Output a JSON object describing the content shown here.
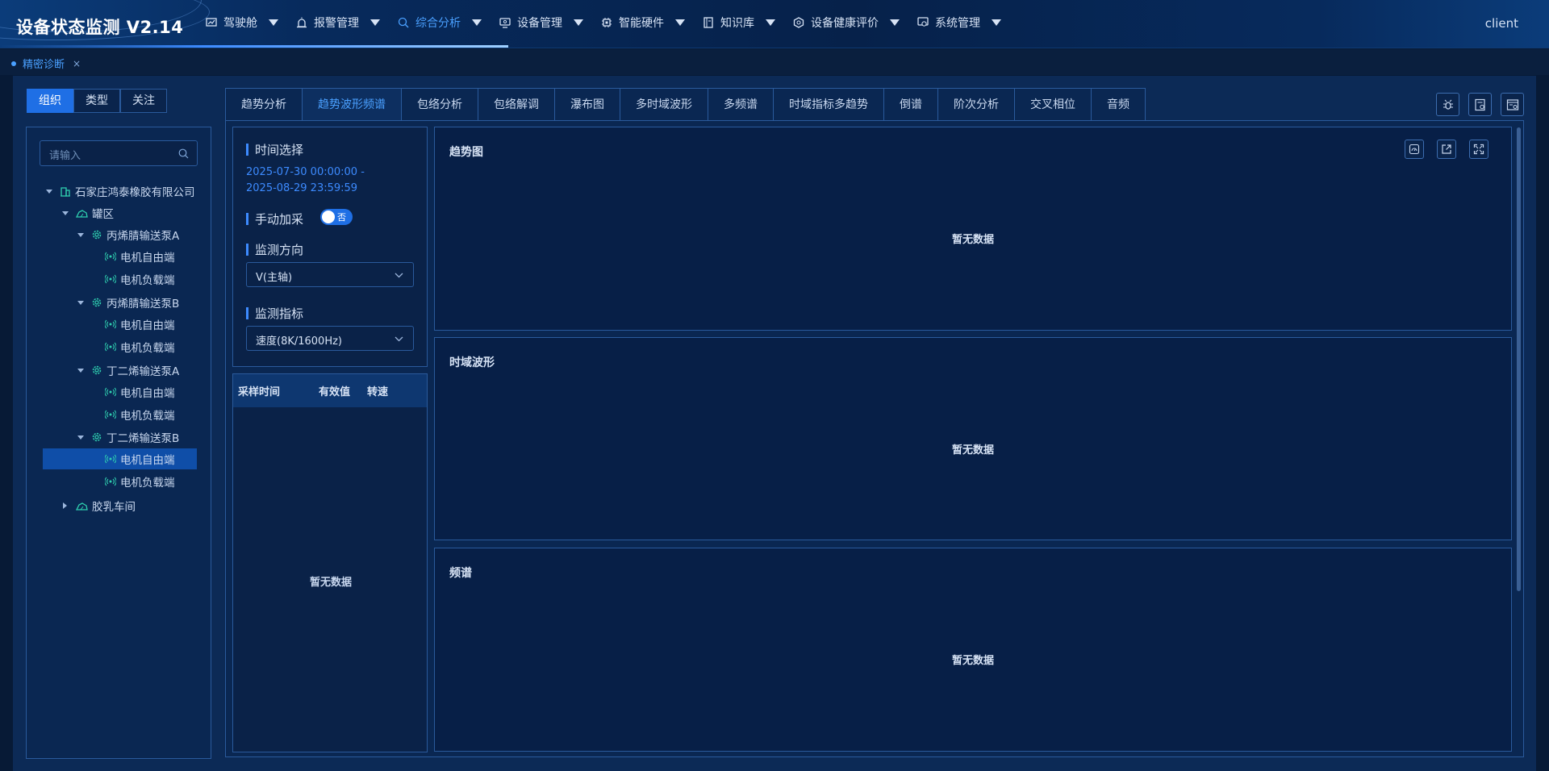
{
  "app": {
    "title": "设备状态监测 V2.14",
    "user": "client"
  },
  "nav": [
    {
      "label": "驾驶舱",
      "icon": "monitor-chart-icon"
    },
    {
      "label": "报警管理",
      "icon": "alarm-light-icon"
    },
    {
      "label": "综合分析",
      "icon": "analysis-search-icon"
    },
    {
      "label": "设备管理",
      "icon": "device-screen-icon"
    },
    {
      "label": "智能硬件",
      "icon": "chip-icon"
    },
    {
      "label": "知识库",
      "icon": "book-icon"
    },
    {
      "label": "设备健康评价",
      "icon": "hexagon-gear-icon"
    },
    {
      "label": "系统管理",
      "icon": "settings-screen-icon"
    }
  ],
  "page_tab": {
    "label": "精密诊断",
    "close": "×"
  },
  "segment": [
    "组织",
    "类型",
    "关注"
  ],
  "search": {
    "placeholder": "请输入"
  },
  "tree": {
    "company": "石家庄鸿泰橡胶有限公司",
    "area1": "罐区",
    "pumpA": "丙烯腈输送泵A",
    "pumpA_m1": "电机自由端",
    "pumpA_m2": "电机负载端",
    "pumpB": "丙烯腈输送泵B",
    "pumpB_m1": "电机自由端",
    "pumpB_m2": "电机负载端",
    "pumpC": "丁二烯输送泵A",
    "pumpC_m1": "电机自由端",
    "pumpC_m2": "电机负载端",
    "pumpD": "丁二烯输送泵B",
    "pumpD_m1": "电机自由端",
    "pumpD_m2": "电机负载端",
    "area2": "胶乳车间"
  },
  "tabs": [
    "趋势分析",
    "趋势波形频谱",
    "包络分析",
    "包络解调",
    "瀑布图",
    "多时域波形",
    "多频谱",
    "时域指标多趋势",
    "倒谱",
    "阶次分析",
    "交叉相位",
    "音频"
  ],
  "params": {
    "time_label": "时间选择",
    "time_start": "2025-07-30 00:00:00 -",
    "time_end": "2025-08-29 23:59:59",
    "manual_label": "手动加采",
    "manual_value": "否",
    "direction_label": "监测方向",
    "direction_value": "V(主轴)",
    "indicator_label": "监测指标",
    "indicator_value": "速度(8K/1600Hz)"
  },
  "table": {
    "columns": [
      "采样时间",
      "有效值",
      "转速"
    ],
    "empty": "暂无数据"
  },
  "charts": [
    {
      "title": "趋势图",
      "empty": "暂无数据"
    },
    {
      "title": "时域波形",
      "empty": "暂无数据"
    },
    {
      "title": "频谱",
      "empty": "暂无数据"
    }
  ],
  "colors": {
    "accent": "#3d8bff",
    "active_tab": "#4aa0ff",
    "bg": "#071a36",
    "selected_row": "#0f4ea8"
  }
}
